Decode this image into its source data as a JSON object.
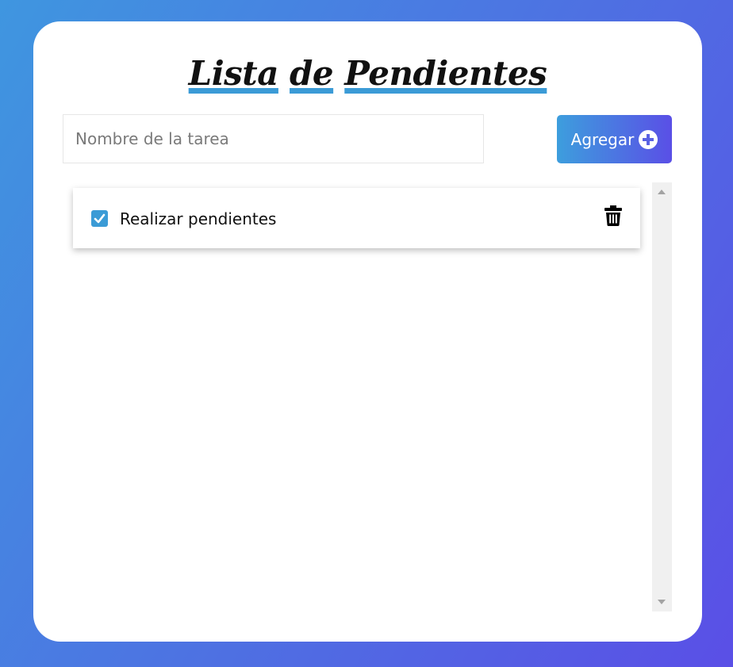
{
  "app": {
    "title_words": [
      "Lista",
      "de",
      "Pendientes"
    ]
  },
  "form": {
    "input_value": "",
    "input_placeholder": "Nombre de la tarea",
    "add_button_label": "Agregar",
    "add_icon": "plus-circle-icon"
  },
  "tasks": [
    {
      "label": "Realizar pendientes",
      "completed": true,
      "delete_icon": "trash-icon"
    }
  ],
  "colors": {
    "accent": "#3b9bd6",
    "gradient_start": "#3d9edd",
    "gradient_end": "#5a4fe6",
    "card_background": "#ffffff"
  }
}
